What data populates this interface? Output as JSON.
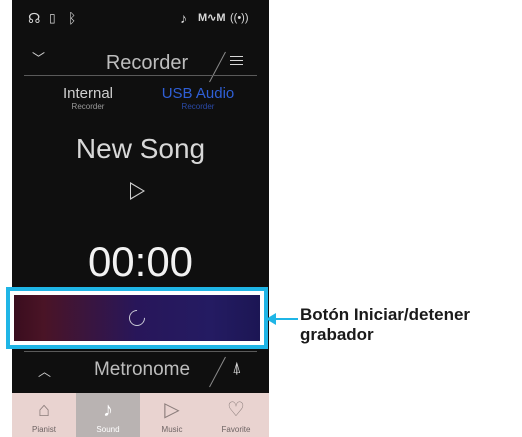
{
  "recorder": {
    "title": "Recorder",
    "tabs": [
      {
        "label": "Internal",
        "sublabel": "Recorder",
        "active": true
      },
      {
        "label": "USB Audio",
        "sublabel": "Recorder",
        "active": false
      }
    ],
    "song_name": "New Song",
    "time": "00:00",
    "record_button_state": "spinner-icon"
  },
  "metronome": {
    "title": "Metronome"
  },
  "nav": {
    "items": [
      {
        "label": "Pianist",
        "icon": "piano-icon",
        "active": false
      },
      {
        "label": "Sound",
        "icon": "music-note-icon",
        "active": true
      },
      {
        "label": "Music",
        "icon": "play-icon",
        "active": false
      },
      {
        "label": "Favorite",
        "icon": "heart-icon",
        "active": false
      }
    ]
  },
  "status_icons": [
    "headphones-icon",
    "usb-drive-icon",
    "bluetooth-icon",
    "microphone-icon",
    "audio-wave-icon",
    "wireless-icon"
  ],
  "callout": {
    "line1": "Botón Iniciar/detener",
    "line2": "grabador"
  },
  "colors": {
    "accent_cyan": "#1fb5e6",
    "usb_tab": "#2f5fd6",
    "nav_bg": "#e9d3d0"
  }
}
